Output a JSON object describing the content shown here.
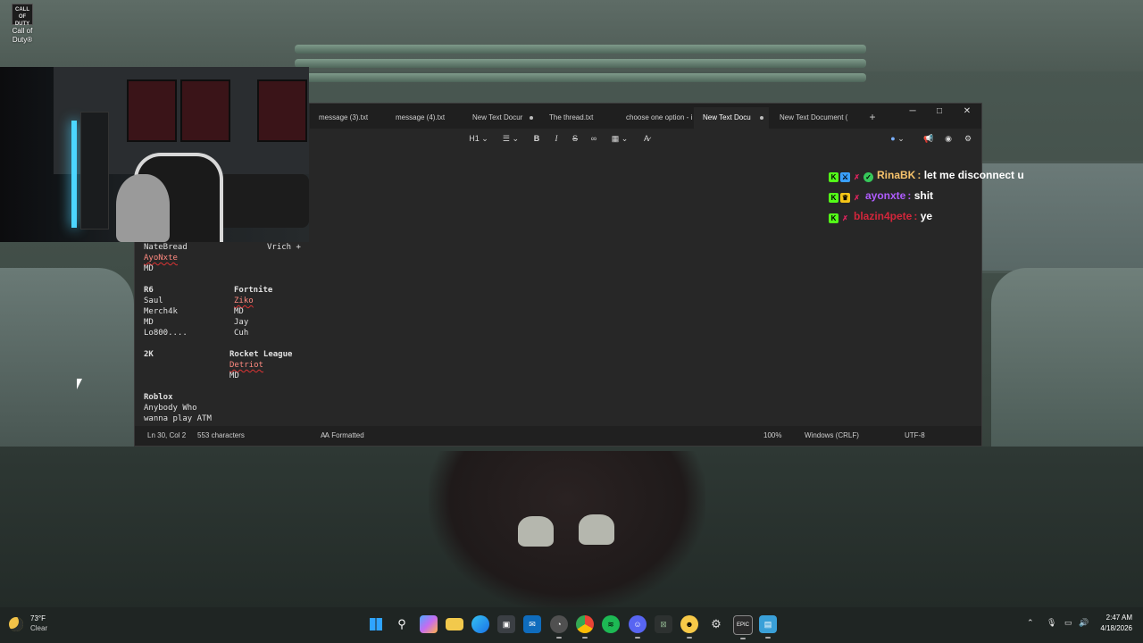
{
  "desktop": {
    "icon_label": "Call of Duty®",
    "icon_art_text": "CALL OF DUTY"
  },
  "notepad": {
    "tabs": [
      {
        "label": "message (3).txt",
        "modified": false
      },
      {
        "label": "message (4).txt",
        "modified": false
      },
      {
        "label": "New Text Docur",
        "modified": true
      },
      {
        "label": "The thread.txt",
        "modified": false
      },
      {
        "label": "choose one option - i",
        "modified": false
      },
      {
        "label": "New Text Docu",
        "modified": true,
        "active": true
      },
      {
        "label": "New Text Document (",
        "modified": false
      }
    ],
    "new_tab": "+",
    "window_buttons": {
      "minimize": "─",
      "maximize": "□",
      "close": "✕"
    },
    "toolbar": {
      "heading": "H1",
      "bold": "B",
      "italic": "I",
      "strike": "S"
    },
    "content": {
      "col1": [
        {
          "text": "NateBread",
          "bold": false,
          "spell": false
        },
        {
          "text": "AyoNxte",
          "bold": false,
          "spell": true
        },
        {
          "text": "MD",
          "bold": false,
          "spell": false
        },
        {
          "text": "",
          "bold": false,
          "spell": false
        },
        {
          "text": "R6",
          "bold": true,
          "spell": false
        },
        {
          "text": "Saul",
          "bold": false,
          "spell": false
        },
        {
          "text": "Merch4k",
          "bold": false,
          "spell": false
        },
        {
          "text": "MD",
          "bold": false,
          "spell": false
        },
        {
          "text": "Lo800....",
          "bold": false,
          "spell": false
        },
        {
          "text": "",
          "bold": false,
          "spell": false
        },
        {
          "text": "2K",
          "bold": true,
          "spell": false
        },
        {
          "text": "",
          "bold": false,
          "spell": false
        },
        {
          "text": "",
          "bold": false,
          "spell": false
        },
        {
          "text": "",
          "bold": false,
          "spell": false
        },
        {
          "text": "Roblox",
          "bold": true,
          "spell": false
        },
        {
          "text": "Anybody Who",
          "bold": false,
          "spell": false
        },
        {
          "text": "wanna play ATM",
          "bold": false,
          "spell": false
        }
      ],
      "vrich": "Vrich +",
      "fortnite": [
        {
          "text": "Fortnite",
          "bold": true,
          "spell": false
        },
        {
          "text": "Ziko",
          "bold": false,
          "spell": true
        },
        {
          "text": "MD",
          "bold": false,
          "spell": false
        },
        {
          "text": "Jay",
          "bold": false,
          "spell": false
        },
        {
          "text": "Cuh",
          "bold": false,
          "spell": false
        }
      ],
      "rocket": [
        {
          "text": "Rocket League",
          "bold": true,
          "spell": false
        },
        {
          "text": "Detriot",
          "bold": false,
          "spell": true
        },
        {
          "text": "MD",
          "bold": false,
          "spell": false
        }
      ]
    },
    "status": {
      "position": "Ln 30, Col 2",
      "characters": "553 characters",
      "format": "Formatted",
      "zoom": "100%",
      "line_endings": "Windows (CRLF)",
      "encoding": "UTF-8"
    }
  },
  "chat": [
    {
      "user": "RinaBK",
      "sep": ":",
      "message": "let me disconnect u",
      "color": "#f5c26b"
    },
    {
      "user": "ayonxte",
      "sep": ":",
      "message": "shit",
      "color": "#b05cff"
    },
    {
      "user": "blazin4pete",
      "sep": ":",
      "message": "ye",
      "color": "#d3263b"
    }
  ],
  "taskbar": {
    "weather_temp": "73°F",
    "weather_cond": "Clear",
    "apps": [
      "start-icon",
      "search-icon",
      "copilot-icon",
      "file-explorer-icon",
      "edge-icon",
      "store-icon",
      "outlook-icon",
      "browser-icon",
      "chrome-icon",
      "spotify-icon",
      "discord-icon",
      "xbox-icon",
      "messenger-icon",
      "steam-icon",
      "epic-games-icon",
      "notepad-icon"
    ],
    "epic_label": "EPIC",
    "time": "2:47 AM",
    "date": "4/18/2026"
  }
}
